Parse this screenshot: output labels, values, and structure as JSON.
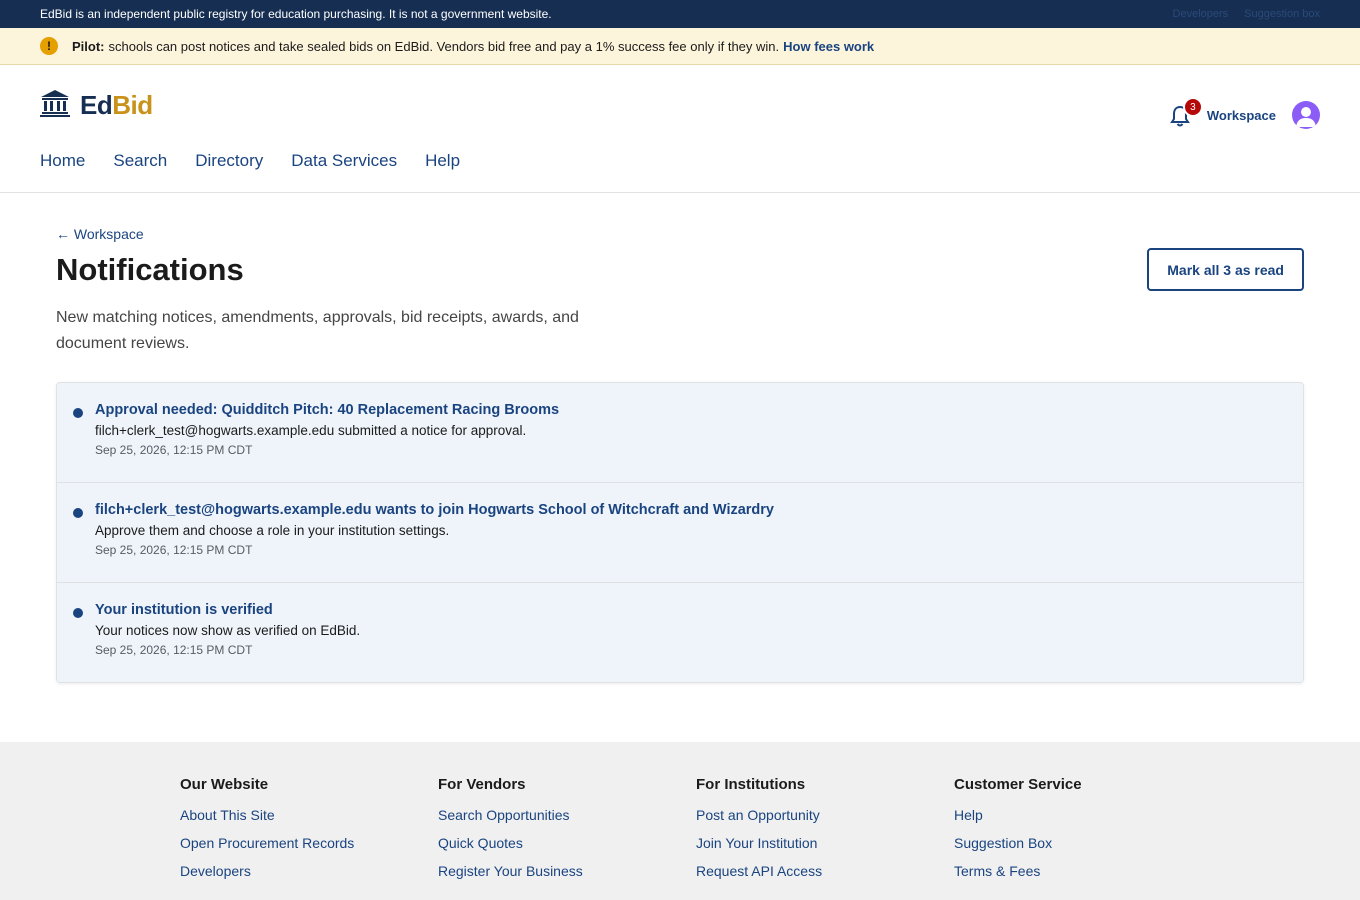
{
  "topbar": {
    "text": "EdBid is an independent public registry for education purchasing. It is not a government website.",
    "links": [
      "Developers",
      "Suggestion box"
    ]
  },
  "alert": {
    "icon": "warning-icon",
    "label": "Pilot:",
    "text": "schools can post notices and take sealed bids on EdBid. Vendors bid free and pay a 1% success fee only if they win.",
    "link": "How fees work"
  },
  "header": {
    "logo_ed": "Ed",
    "logo_bid": "Bid",
    "logo_icon": "institution-icon",
    "nav": [
      "Home",
      "Search",
      "Directory",
      "Data Services",
      "Help"
    ],
    "notification_count": "3",
    "workspace_label": "Workspace"
  },
  "main": {
    "back_label": "Workspace",
    "title": "Notifications",
    "mark_all_label": "Mark all 3 as read",
    "subtitle": "New matching notices, amendments, approvals, bid receipts, awards, and document reviews.",
    "notifications": [
      {
        "title": "Approval needed: Quidditch Pitch: 40 Replacement Racing Brooms",
        "body": "filch+clerk_test@hogwarts.example.edu submitted a notice for approval.",
        "time": "Sep 25, 2026, 12:15 PM CDT"
      },
      {
        "title": "filch+clerk_test@hogwarts.example.edu wants to join Hogwarts School of Witchcraft and Wizardry",
        "body": "Approve them and choose a role in your institution settings.",
        "time": "Sep 25, 2026, 12:15 PM CDT"
      },
      {
        "title": "Your institution is verified",
        "body": "Your notices now show as verified on EdBid.",
        "time": "Sep 25, 2026, 12:15 PM CDT"
      }
    ]
  },
  "footer": {
    "columns": [
      {
        "heading": "Our Website",
        "links": [
          "About This Site",
          "Open Procurement Records",
          "Developers"
        ]
      },
      {
        "heading": "For Vendors",
        "links": [
          "Search Opportunities",
          "Quick Quotes",
          "Register Your Business"
        ]
      },
      {
        "heading": "For Institutions",
        "links": [
          "Post an Opportunity",
          "Join Your Institution",
          "Request API Access"
        ]
      },
      {
        "heading": "Customer Service",
        "links": [
          "Help",
          "Suggestion Box",
          "Terms & Fees"
        ]
      }
    ]
  },
  "colors": {
    "primary": "#1a4480",
    "banner": "#162e51",
    "accent_gold": "#c9921a",
    "alert_bg": "#fdf4dc",
    "unread_bg": "#eff4fb",
    "badge": "#b50909"
  }
}
